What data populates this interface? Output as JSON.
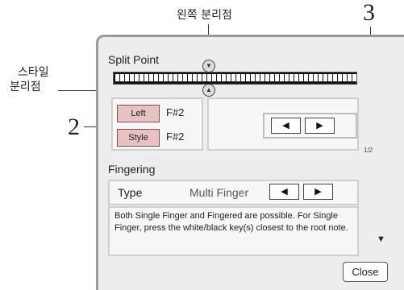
{
  "annotations": {
    "left_split_point": "왼쪽 분리점",
    "style_split_point_line1": "스타일",
    "style_split_point_line2": "분리점",
    "callout_2": "2",
    "callout_3": "3"
  },
  "split_point": {
    "title": "Split Point",
    "left_marker_glyph": "▼",
    "style_marker_glyph": "▲",
    "parts": [
      {
        "label": "Left",
        "note": "F#2"
      },
      {
        "label": "Style",
        "note": "F#2"
      }
    ],
    "prev_glyph": "◀",
    "next_glyph": "▶",
    "page_indicator": "1/2"
  },
  "fingering": {
    "title": "Fingering",
    "type_label": "Type",
    "type_value": "Multi Finger",
    "prev_glyph": "◀",
    "next_glyph": "▶",
    "description": "Both Single Finger and Fingered are possible. For Single Finger, press the white/black key(s) closest to the root note.",
    "scroll_glyph": "▼"
  },
  "close_label": "Close",
  "colors": {
    "part_button": "#e8c2c2",
    "panel_bg": "#ededed",
    "frame": "#9a9a9a"
  }
}
